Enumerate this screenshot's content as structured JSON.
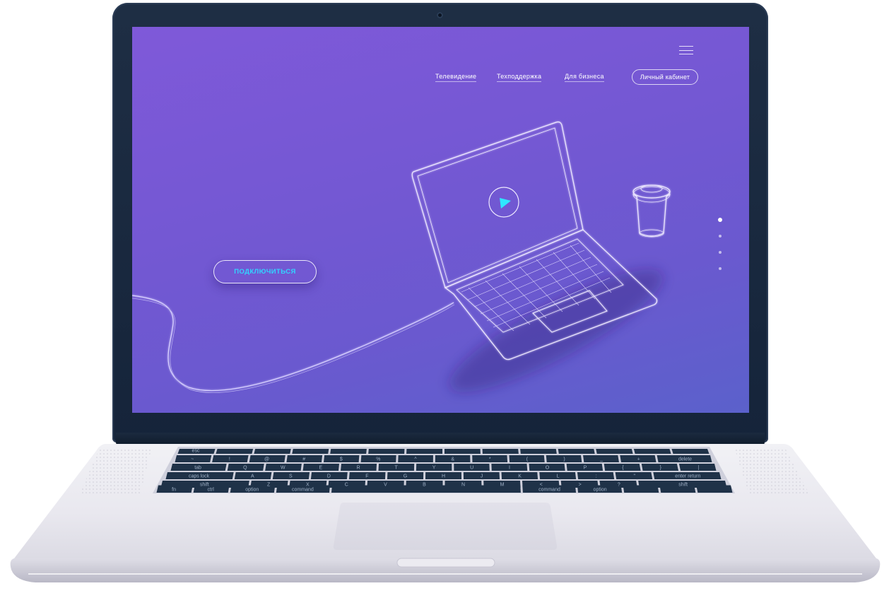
{
  "site": {
    "nav": [
      {
        "label": "Телевидение"
      },
      {
        "label": "Техподдержка"
      },
      {
        "label": "Для бизнеса"
      }
    ],
    "account_label": "Личный кабинет",
    "cta_label": "ПОДКЛЮЧИТЬСЯ",
    "slider": {
      "count": 4,
      "active": 1
    }
  },
  "keyboard": {
    "row1": [
      "esc",
      "",
      "",
      "",
      "",
      "",
      "",
      "",
      "",
      "",
      "",
      "",
      "",
      ""
    ],
    "row2": [
      "~",
      "!",
      "@",
      "#",
      "$",
      "%",
      "^",
      "&",
      "*",
      "(",
      ")",
      "_",
      "+",
      "delete"
    ],
    "row3": [
      "tab",
      "Q",
      "W",
      "E",
      "R",
      "T",
      "Y",
      "U",
      "I",
      "O",
      "P",
      "{",
      "}",
      "|"
    ],
    "row4": [
      "caps lock",
      "A",
      "S",
      "D",
      "F",
      "G",
      "H",
      "J",
      "K",
      "L",
      ":",
      "\"",
      "enter return"
    ],
    "row5": [
      "shift",
      "Z",
      "X",
      "C",
      "V",
      "B",
      "N",
      "M",
      "<",
      ">",
      "?",
      "shift"
    ],
    "row6": [
      "fn",
      "ctrl",
      "option",
      "command",
      "",
      "command",
      "option",
      "",
      "",
      ""
    ]
  },
  "colors": {
    "screen_top": "#7f59d9",
    "screen_bottom": "#5b61cb",
    "cta_text": "#32d4ff",
    "play_icon": "#2ee6ff",
    "bezel": "#15243a"
  }
}
